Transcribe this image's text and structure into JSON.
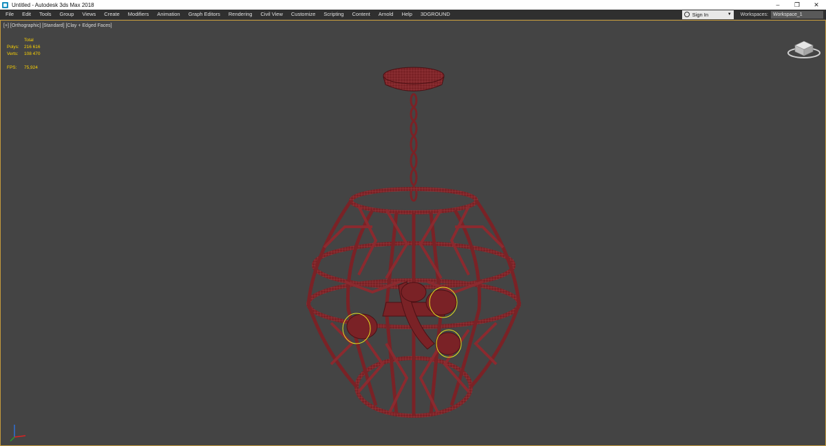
{
  "window": {
    "title": "Untitled - Autodesk 3ds Max 2018"
  },
  "menubar": {
    "items": [
      "File",
      "Edit",
      "Tools",
      "Group",
      "Views",
      "Create",
      "Modifiers",
      "Animation",
      "Graph Editors",
      "Rendering",
      "Civil View",
      "Customize",
      "Scripting",
      "Content",
      "Arnold",
      "Help",
      "3DGROUND"
    ],
    "sign_in": "Sign In",
    "workspaces_label": "Workspaces:",
    "workspace_value": "Workspace_1"
  },
  "viewport": {
    "label": "[+] [Orthographic] [Standard] [Clay + Edged Faces]",
    "stats": {
      "total_label": "Total",
      "polys_label": "Polys:",
      "polys_value": "216 616",
      "verts_label": "Verts:",
      "verts_value": "108 470",
      "fps_label": "FPS:",
      "fps_value": "75,924"
    }
  },
  "colors": {
    "viewport_bg": "#444444",
    "model": "#7a2226",
    "model_wire": "#b04a4f",
    "selection_gizmo": "#e4e41f",
    "stats_text": "#ffd400",
    "viewport_border": "#c69b3d"
  }
}
